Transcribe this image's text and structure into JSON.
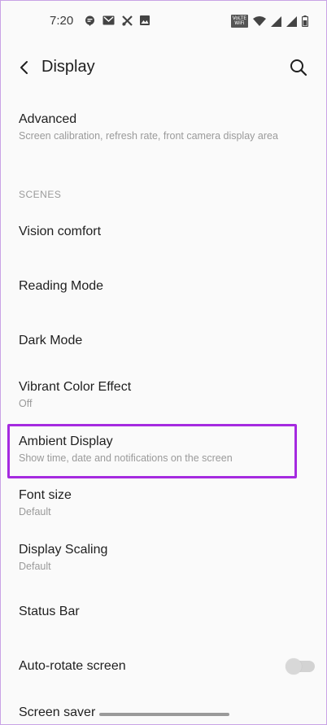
{
  "status_bar": {
    "time": "7:20",
    "left_icons": [
      "chat-bubble-icon",
      "gmail-icon",
      "tools-icon",
      "image-icon"
    ],
    "right_icons": [
      "volte-wifi-icon",
      "wifi-icon",
      "signal-1-icon",
      "signal-2-icon",
      "battery-icon"
    ],
    "volte_line1": "VoLTE",
    "volte_line2": "WiFi"
  },
  "app_bar": {
    "title": "Display"
  },
  "items": [
    {
      "title": "Advanced",
      "subtitle": "Screen calibration, refresh rate, front camera display area"
    },
    {
      "title": "Vision comfort"
    },
    {
      "title": "Reading Mode"
    },
    {
      "title": "Dark Mode"
    },
    {
      "title": "Vibrant Color Effect",
      "subtitle": "Off"
    },
    {
      "title": "Ambient Display",
      "subtitle": "Show time, date and notifications on the screen"
    },
    {
      "title": "Font size",
      "subtitle": "Default"
    },
    {
      "title": "Display Scaling",
      "subtitle": "Default"
    },
    {
      "title": "Status Bar"
    },
    {
      "title": "Auto-rotate screen",
      "toggle_on": false
    },
    {
      "title": "Screen saver"
    }
  ],
  "section_header": "SCENES",
  "colors": {
    "highlight": "#a52ae0",
    "background": "#fafafa"
  }
}
